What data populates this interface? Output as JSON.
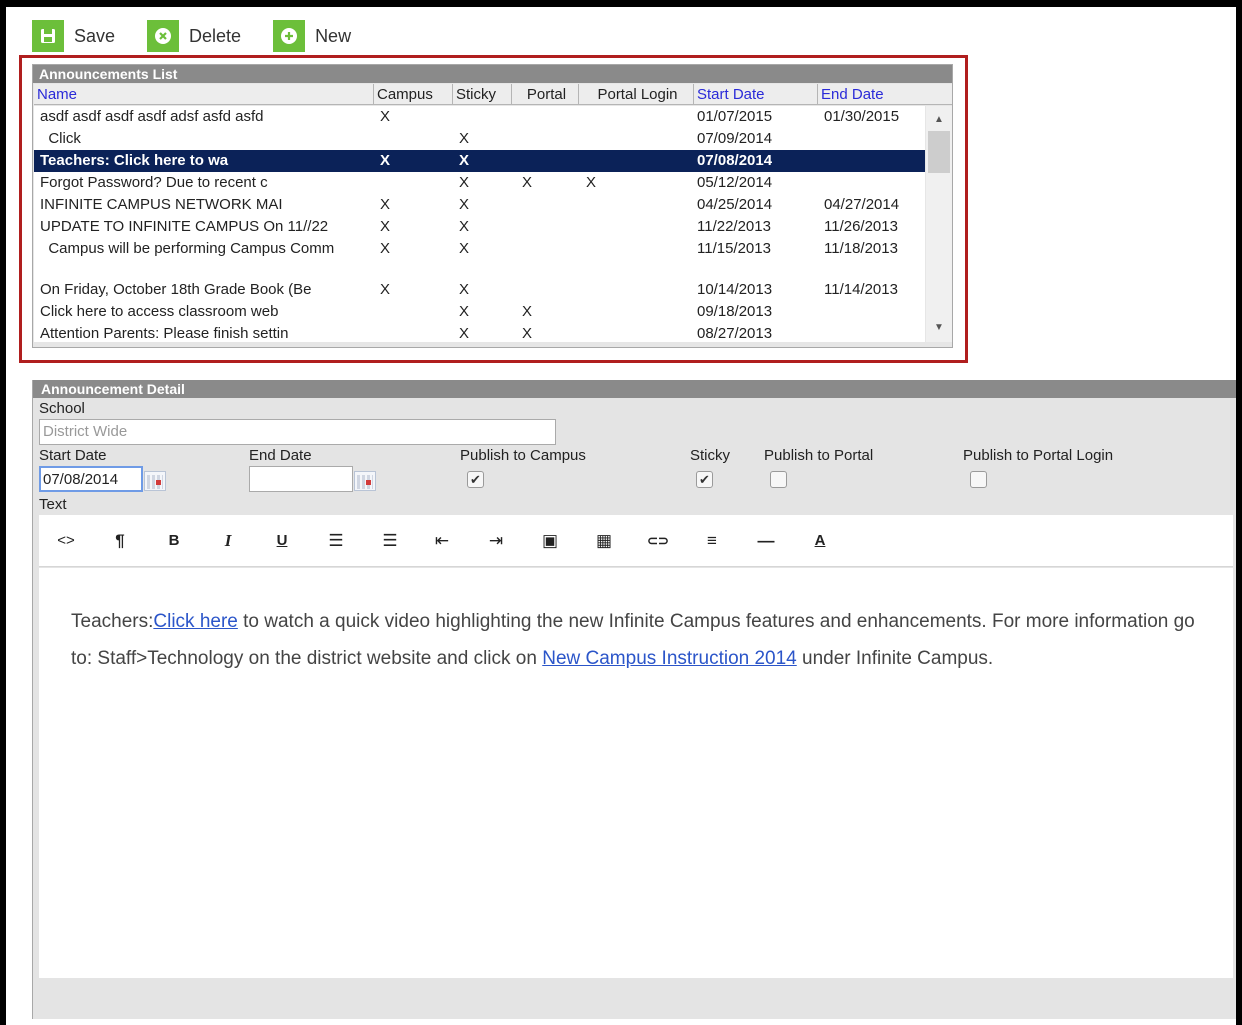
{
  "toolbar": {
    "save_label": "Save",
    "delete_label": "Delete",
    "new_label": "New",
    "icon_color": "#6cbf3a"
  },
  "list": {
    "title": "Announcements List",
    "columns": [
      "Name",
      "Campus",
      "Sticky",
      "Portal",
      "Portal Login",
      "Start Date",
      "End Date"
    ],
    "sortable_color": "#2a2ad8",
    "selected_color": "#0b2258",
    "rows": [
      {
        "name": "asdf asdf asdf     asdf adsf asfd asfd",
        "campus": "X",
        "sticky": "",
        "portal": "",
        "portal_login": "",
        "start": "01/07/2015",
        "end": "01/30/2015"
      },
      {
        "name": "  Click",
        "campus": "",
        "sticky": "X",
        "portal": "",
        "portal_login": "",
        "start": "07/09/2014",
        "end": ""
      },
      {
        "name": "Teachers: Click here to wa",
        "campus": "X",
        "sticky": "X",
        "portal": "",
        "portal_login": "",
        "start": "07/08/2014",
        "end": ""
      },
      {
        "name": "Forgot Password? Due to recent c",
        "campus": "",
        "sticky": "X",
        "portal": "X",
        "portal_login": "X",
        "start": "05/12/2014",
        "end": ""
      },
      {
        "name": "INFINITE CAMPUS NETWORK MAI",
        "campus": "X",
        "sticky": "X",
        "portal": "",
        "portal_login": "",
        "start": "04/25/2014",
        "end": "04/27/2014"
      },
      {
        "name": "UPDATE TO INFINITE CAMPUS On 11//22",
        "campus": "X",
        "sticky": "X",
        "portal": "",
        "portal_login": "",
        "start": "11/22/2013",
        "end": "11/26/2013"
      },
      {
        "name": "  Campus will be performing Campus Comm",
        "campus": "X",
        "sticky": "X",
        "portal": "",
        "portal_login": "",
        "start": "11/15/2013",
        "end": "11/18/2013"
      },
      {
        "name": "On Friday, October 18th Grade Book (Be",
        "campus": "X",
        "sticky": "X",
        "portal": "",
        "portal_login": "",
        "start": "10/14/2013",
        "end": "11/14/2013"
      },
      {
        "name": "Click here to access classroom web",
        "campus": "",
        "sticky": "X",
        "portal": "X",
        "portal_login": "",
        "start": "09/18/2013",
        "end": ""
      },
      {
        "name": "Attention Parents: Please finish settin",
        "campus": "",
        "sticky": "X",
        "portal": "X",
        "portal_login": "",
        "start": "08/27/2013",
        "end": ""
      }
    ]
  },
  "detail": {
    "title": "Announcement Detail",
    "school_label": "School",
    "school_placeholder": "District Wide",
    "start_date_label": "Start Date",
    "start_date_value": "07/08/2014",
    "end_date_label": "End Date",
    "end_date_value": "",
    "publish_campus_label": "Publish to Campus",
    "sticky_label": "Sticky",
    "publish_portal_label": "Publish to Portal",
    "publish_portal_login_label": "Publish to Portal Login",
    "text_label": "Text",
    "check_mark": "✔",
    "editor_text": {
      "part1": "Teachers:",
      "link1": "Click here",
      "part2": " to watch a quick video highlighting the new Infinite Campus features and enhancements. For more information go to: Staff>Technology on the district website and click on ",
      "link2": "New Campus Instruction 2014",
      "part3": " under Infinite Campus."
    }
  },
  "editor_tools": [
    {
      "name": "code-view-icon",
      "glyph": "<>"
    },
    {
      "name": "paragraph-icon",
      "glyph": "¶"
    },
    {
      "name": "bold-icon",
      "glyph": "B"
    },
    {
      "name": "italic-icon",
      "glyph": "I"
    },
    {
      "name": "underline-icon",
      "glyph": "U"
    },
    {
      "name": "bulleted-list-icon",
      "glyph": "☰"
    },
    {
      "name": "numbered-list-icon",
      "glyph": "☰"
    },
    {
      "name": "outdent-icon",
      "glyph": "⇤"
    },
    {
      "name": "indent-icon",
      "glyph": "⇥"
    },
    {
      "name": "image-icon",
      "glyph": "▣"
    },
    {
      "name": "table-icon",
      "glyph": "▦"
    },
    {
      "name": "link-icon",
      "glyph": "⊂⊃"
    },
    {
      "name": "align-icon",
      "glyph": "≡"
    },
    {
      "name": "horizontal-rule-icon",
      "glyph": "—"
    },
    {
      "name": "font-color-icon",
      "glyph": "A"
    }
  ]
}
